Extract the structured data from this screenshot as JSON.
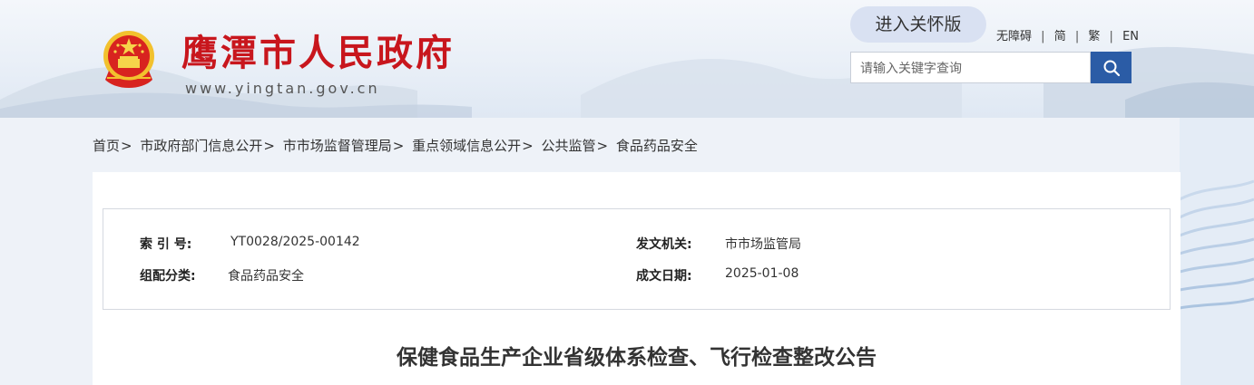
{
  "header": {
    "site_title": "鹰潭市人民政府",
    "site_url": "www.yingtan.gov.cn",
    "care_version_label": "进入关怀版",
    "links": [
      "无障碍",
      "简",
      "繁",
      "EN"
    ],
    "link_separator": "|",
    "search_placeholder": "请输入关键字查询",
    "colors": {
      "title": "#c8161d",
      "search_button": "#2b5ca6",
      "care_button": "#d9e1f2"
    }
  },
  "breadcrumb": [
    "首页",
    "市政府部门信息公开",
    "市市场监督管理局",
    "重点领域信息公开",
    "公共监管",
    "食品药品安全"
  ],
  "breadcrumb_separator": ">",
  "meta": {
    "index_no_label": "索 引 号:",
    "index_no": "YT0028/2025-00142",
    "issuer_label": "发文机关:",
    "issuer": "市市场监管局",
    "category_label": "组配分类:",
    "category": "食品药品安全",
    "date_label": "成文日期:",
    "date": "2025-01-08"
  },
  "article": {
    "title": "保健食品生产企业省级体系检查、飞行检查整改公告"
  }
}
